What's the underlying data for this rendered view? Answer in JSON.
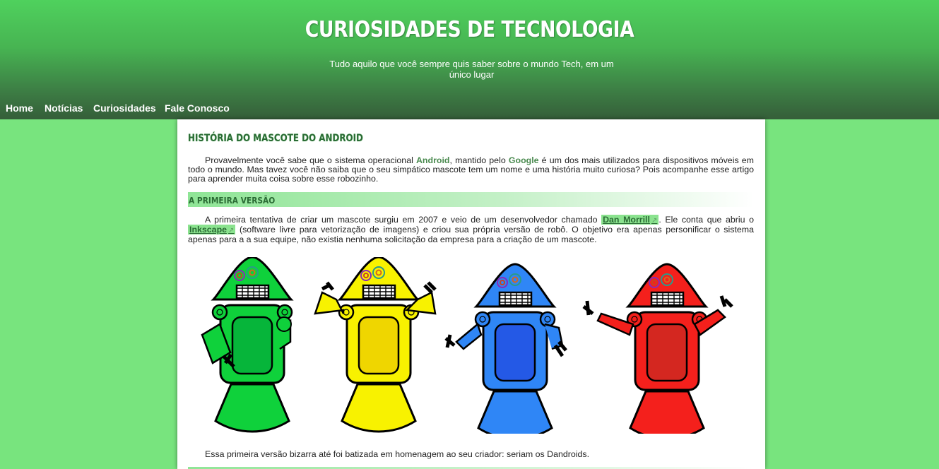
{
  "header": {
    "title": "CURIOSIDADES DE TECNOLOGIA",
    "subtitle": "Tudo aquilo que você sempre quis saber sobre o mundo Tech, em um único lugar"
  },
  "nav": [
    "Home",
    "Notícias",
    "Curiosidades",
    "Fale Conosco"
  ],
  "article": {
    "title": "HISTÓRIA DO MASCOTE DO ANDROID",
    "intro": {
      "t1": "Provavelmente você sabe que o sistema operacional ",
      "kw1": "Android",
      "t2": ", mantido pelo ",
      "kw2": "Google",
      "t3": " é um dos mais utilizados para dispositivos móveis em todo o mundo. Mas tavez você não saiba que o seu simpático mascote tem um nome e uma história muito curiosa? Pois acompanhe esse artigo para aprender muita coisa sobre esse robozinho."
    },
    "section1_title": "A PRIMEIRA VERSÃO",
    "para1": {
      "t1": "A primeira tentativa de criar um mascote surgiu em 2007 e veio de um desenvolvedor chamado ",
      "link1": "Dan Morrill",
      "t2": ". Ele conta que abriu o ",
      "link2": "Inkscape",
      "t3": " (software livre para vetorização de imagens) e criou sua própria versão de robô. O objetivo era apenas personificar o sistema apenas para a a sua equipe, não existia nenhuma solicitação da empresa para a criação de um mascote."
    },
    "external_link_icon": "↗",
    "robot_colors": [
      "#0fd13b",
      "#f8f200",
      "#2f86f6",
      "#f4201c"
    ],
    "robot_body_colors": [
      "#06b53a",
      "#efd600",
      "#2459e6",
      "#d42720"
    ],
    "para2": "Essa primeira versão bizarra até foi batizada em homenagem ao seu criador: seriam os Dandroids."
  }
}
